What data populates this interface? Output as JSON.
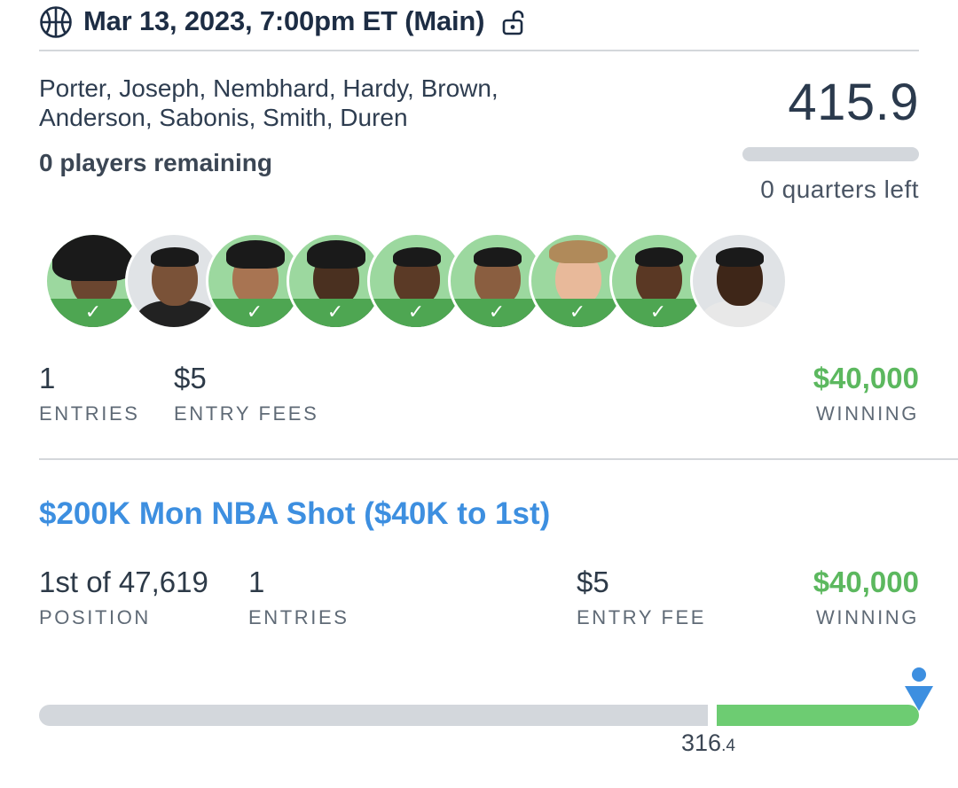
{
  "header": {
    "title": "Mar 13, 2023, 7:00pm ET (Main)",
    "sport_icon": "basketball-icon",
    "lock_icon": "unlocked-icon"
  },
  "lineup": {
    "players_line1": "Porter, Joseph, Nembhard, Hardy, Brown,",
    "players_line2": "Anderson, Sabonis, Smith, Duren",
    "remaining": "0 players remaining",
    "score": "415.9",
    "quarters_left": "0 quarters left",
    "avatars": [
      {
        "status": "done",
        "skin": "#6b4630",
        "shirt": "#3a3a3a",
        "hair": "afro"
      },
      {
        "status": "pending",
        "skin": "#7a5238",
        "shirt": "#222222",
        "hair": "short"
      },
      {
        "status": "done",
        "skin": "#a87452",
        "shirt": "#2f4f2f",
        "hair": "curly"
      },
      {
        "status": "done",
        "skin": "#4a3020",
        "shirt": "#2a2a2a",
        "hair": "braids"
      },
      {
        "status": "done",
        "skin": "#5b3a26",
        "shirt": "#1e5b3a",
        "hair": "short"
      },
      {
        "status": "done",
        "skin": "#8a5e40",
        "shirt": "#1f1f1f",
        "hair": "short"
      },
      {
        "status": "done",
        "skin": "#e8b99a",
        "shirt": "#3a3a3a",
        "hair": "light"
      },
      {
        "status": "done",
        "skin": "#5a3824",
        "shirt": "#1f1f1f",
        "hair": "short"
      },
      {
        "status": "pending",
        "skin": "#3e2618",
        "shirt": "#e8e8e8",
        "hair": "short"
      }
    ],
    "check_glyph": "✓"
  },
  "summary": {
    "entries_value": "1",
    "entries_label": "ENTRIES",
    "fees_value": "$5",
    "fees_label": "ENTRY FEES",
    "winning_value": "$40,000",
    "winning_label": "WINNING"
  },
  "contest": {
    "title": "$200K Mon NBA Shot ($40K to 1st)",
    "position_value": "1st of 47,619",
    "position_label": "POSITION",
    "entries_value": "1",
    "entries_label": "ENTRIES",
    "fee_value": "$5",
    "fee_label": "ENTRY FEE",
    "winning_value": "$40,000",
    "winning_label": "WINNING",
    "cash_line_main": "316",
    "cash_line_decimal": ".4",
    "progress_fraction": 1.0
  },
  "colors": {
    "accent_blue": "#3d8fe0",
    "winning_green": "#5cb85f",
    "check_green": "#4ea652"
  }
}
